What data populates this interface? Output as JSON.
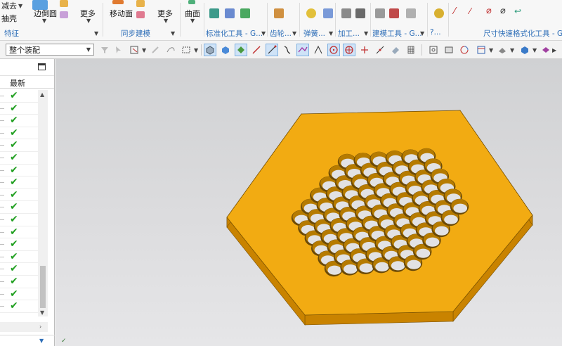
{
  "ribbon": {
    "top_row": {
      "item1": "减去",
      "item2": "抽壳",
      "item3": "边倒圆",
      "more1": "更多",
      "item4": "移动面",
      "more2": "更多",
      "item5": "曲面"
    },
    "groups": {
      "feature": "特征",
      "sync": "同步建模",
      "std": "标准化工具 - G...",
      "gear": "齿轮...",
      "spring": "弹簧...",
      "machining": "加工...",
      "modeling": "建模工具 - G...",
      "misc": "?...",
      "dimension": "尺寸快速格式化工具 - GC"
    }
  },
  "toolbar": {
    "assembly_select": "整个装配"
  },
  "navigator": {
    "column_header": "最新",
    "row_count": 18
  },
  "colors": {
    "part": "#f2ab12",
    "part_side": "#c98300",
    "group_label": "#2f6fb8",
    "check": "#22a022"
  }
}
